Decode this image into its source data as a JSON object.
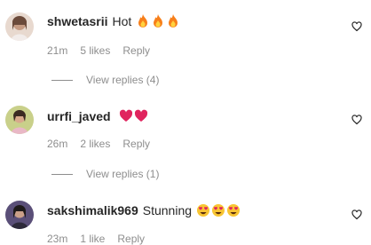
{
  "comments": [
    {
      "username": "shwetasrii",
      "text": "Hot",
      "emojis": [
        "fire-emoji",
        "fire-emoji",
        "fire-emoji"
      ],
      "time": "21m",
      "likes": "5 likes",
      "reply": "Reply",
      "view_replies": "View replies (4)"
    },
    {
      "username": "urrfi_javed",
      "text": "",
      "emojis": [
        "red-heart-emoji",
        "red-heart-emoji"
      ],
      "time": "26m",
      "likes": "2 likes",
      "reply": "Reply",
      "view_replies": "View replies (1)"
    },
    {
      "username": "sakshimalik969",
      "text": "Stunning",
      "emojis": [
        "heart-eyes-emoji",
        "heart-eyes-emoji",
        "heart-eyes-emoji"
      ],
      "time": "23m",
      "likes": "1 like",
      "reply": "Reply"
    }
  ],
  "colors": {
    "text_primary": "#262626",
    "text_secondary": "#8e8e8e",
    "fire": "#f77f1a",
    "heart_red": "#e0245e"
  },
  "icons": {
    "like": "heart-outline-icon"
  }
}
